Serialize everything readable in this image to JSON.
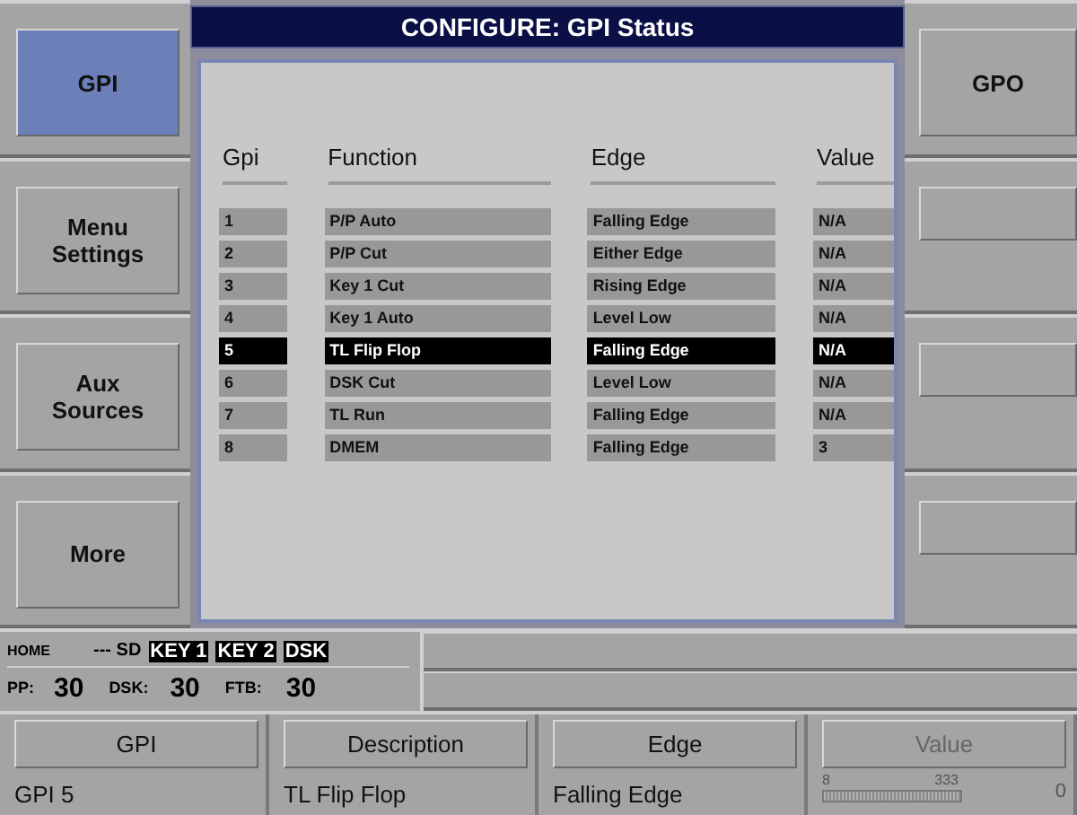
{
  "title": "CONFIGURE: GPI Status",
  "left_buttons": [
    {
      "label": "GPI",
      "selected": true
    },
    {
      "label": "Menu Settings",
      "selected": false
    },
    {
      "label": "Aux Sources",
      "selected": false
    },
    {
      "label": "More",
      "selected": false
    }
  ],
  "right_buttons": [
    {
      "kind": "button",
      "label": "GPO"
    },
    {
      "kind": "blank"
    },
    {
      "kind": "blank"
    },
    {
      "kind": "blank"
    }
  ],
  "table": {
    "columns": [
      "Gpi",
      "Function",
      "Edge",
      "Value"
    ],
    "rows": [
      {
        "cells": [
          "1",
          "P/P Auto",
          "Falling Edge",
          "N/A"
        ],
        "selected": false
      },
      {
        "cells": [
          "2",
          "P/P Cut",
          "Either Edge",
          "N/A"
        ],
        "selected": false
      },
      {
        "cells": [
          "3",
          "Key 1 Cut",
          "Rising Edge",
          "N/A"
        ],
        "selected": false
      },
      {
        "cells": [
          "4",
          "Key 1 Auto",
          "Level Low",
          "N/A"
        ],
        "selected": false
      },
      {
        "cells": [
          "5",
          "TL Flip Flop",
          "Falling Edge",
          "N/A"
        ],
        "selected": true
      },
      {
        "cells": [
          "6",
          "DSK Cut",
          "Level Low",
          "N/A"
        ],
        "selected": false
      },
      {
        "cells": [
          "7",
          "TL Run",
          "Falling Edge",
          "N/A"
        ],
        "selected": false
      },
      {
        "cells": [
          "8",
          "DMEM",
          "Falling Edge",
          "3"
        ],
        "selected": false
      }
    ]
  },
  "status_bar": {
    "mode": "HOME",
    "format": "--- SD",
    "indicators": [
      {
        "label": "KEY 1",
        "on": true
      },
      {
        "label": "KEY 2",
        "on": true
      },
      {
        "label": "DSK",
        "on": true
      }
    ],
    "rates": [
      {
        "label": "PP:",
        "value": "30"
      },
      {
        "label": "DSK:",
        "value": "30"
      },
      {
        "label": "FTB:",
        "value": "30"
      }
    ]
  },
  "knobs": [
    {
      "kind": "text",
      "header": "GPI",
      "disabled": false,
      "value": "GPI 5"
    },
    {
      "kind": "text",
      "header": "Description",
      "disabled": false,
      "value": "TL Flip Flop"
    },
    {
      "kind": "text",
      "header": "Edge",
      "disabled": false,
      "value": "Falling Edge"
    },
    {
      "kind": "slider",
      "header": "Value",
      "disabled": true,
      "min": "8",
      "reading": "333",
      "max": "0",
      "level": 1
    }
  ]
}
